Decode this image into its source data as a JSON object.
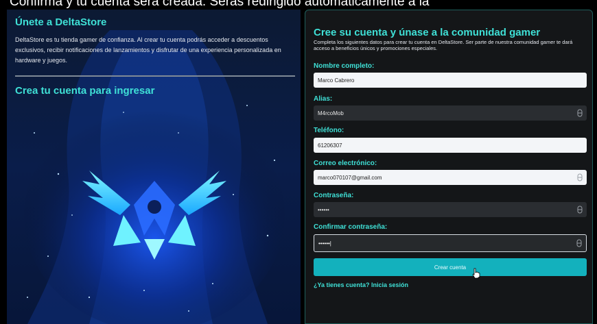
{
  "banner": {
    "text": "Confirma y tu cuenta será creada. Serás redirigido automáticamente a la"
  },
  "left": {
    "title": "Únete a DeltaStore",
    "description": "DeltaStore es tu tienda gamer de confianza. Al crear tu cuenta podrás acceder a descuentos exclusivos, recibir notificaciones de lanzamientos y disfrutar de una experiencia personalizada en hardware y juegos.",
    "subtitle": "Crea tu cuenta para ingresar"
  },
  "form": {
    "title": "Cree su cuenta y únase a la comunidad gamer",
    "description": "Completa los siguientes datos para crear tu cuenta en DeltaStore. Ser parte de nuestra comunidad gamer te dará acceso a beneficios únicos y promociones especiales.",
    "fields": [
      {
        "label": "Nombre completo:",
        "value": "Marco Cabrero"
      },
      {
        "label": "Alias:",
        "value": "M4rcoMob"
      },
      {
        "label": "Teléfono:",
        "value": "61206307"
      },
      {
        "label": "Correo electrónico:",
        "value": "marco070107@gmail.com"
      },
      {
        "label": "Contraseña:",
        "value": "••••••"
      },
      {
        "label": "Confirmar contraseña:",
        "value": "••••••|"
      }
    ],
    "submit_label": "Crear cuenta",
    "login_link": "¿Ya tienes cuenta? Inicia sesión"
  },
  "icons": {
    "eye": "eye-icon",
    "cursor": "hand-cursor-icon"
  },
  "colors": {
    "accent": "#3fe0d6",
    "button": "#13b1bd",
    "panel": "#141618",
    "border": "#1e5f5c"
  }
}
